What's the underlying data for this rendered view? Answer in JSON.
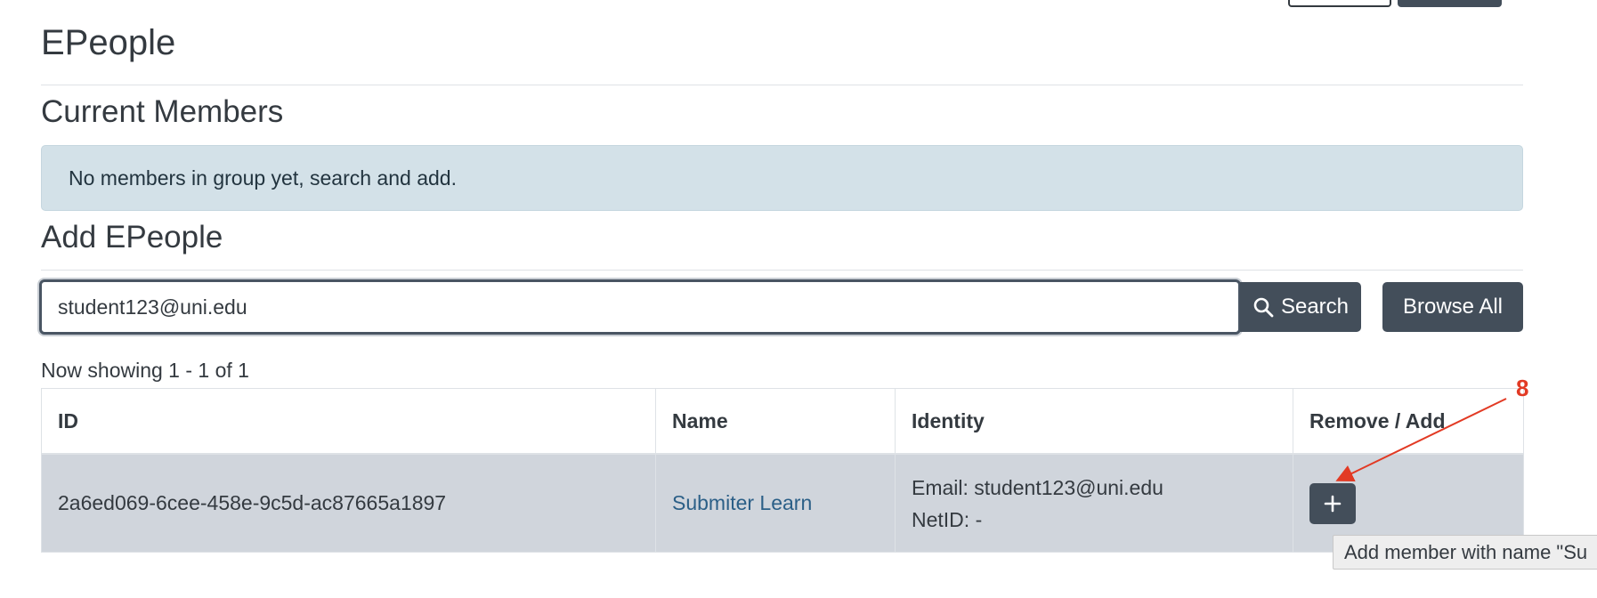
{
  "page": {
    "title": "EPeople",
    "current_members_heading": "Current Members",
    "no_members_alert": "No members in group yet, search and add.",
    "add_heading": "Add EPeople"
  },
  "search": {
    "value": "student123@uni.edu",
    "search_label": "Search",
    "browse_label": "Browse All"
  },
  "results": {
    "showing": "Now showing 1 - 1 of 1",
    "columns": [
      "ID",
      "Name",
      "Identity",
      "Remove / Add"
    ],
    "rows": [
      {
        "id": "2a6ed069-6cee-458e-9c5d-ac87665a1897",
        "name": "Submiter Learn",
        "email": "Email: student123@uni.edu",
        "netid": "NetID: -"
      }
    ]
  },
  "tooltip": "Add member with name \"Su",
  "annotation": {
    "label": "8",
    "color": "#e23a24"
  },
  "colors": {
    "button_dark": "#434e5a",
    "row_bg": "#d0d5dc",
    "alert_bg": "#d3e1e8",
    "link": "#2b5f87"
  }
}
